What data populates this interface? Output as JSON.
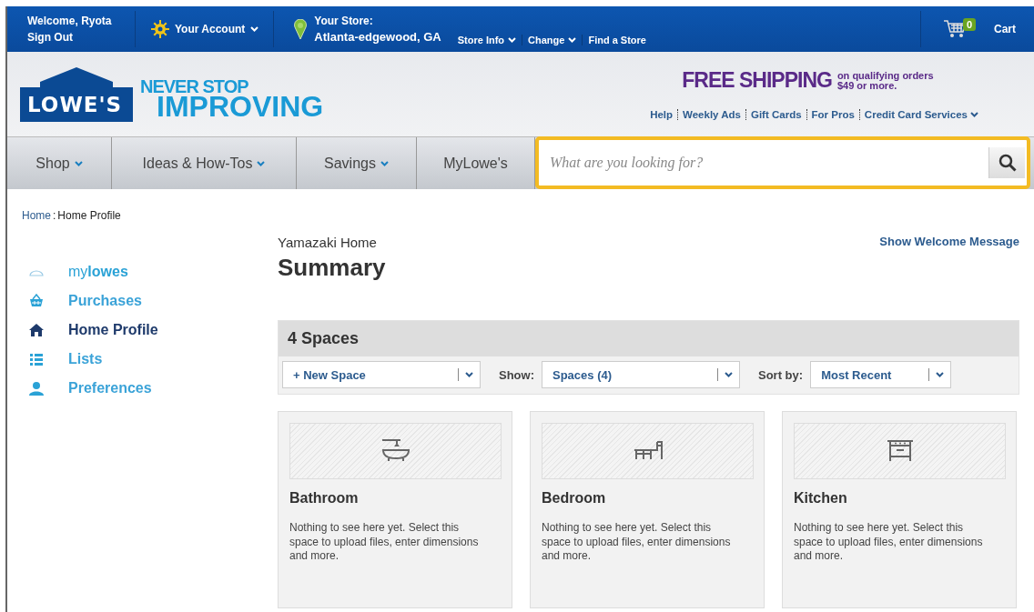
{
  "top_bar": {
    "welcome": "Welcome, Ryota",
    "sign_out": "Sign Out",
    "account": "Your Account",
    "store_label": "Your Store:",
    "store_name": "Atlanta-edgewood, GA",
    "store_links": [
      {
        "label": "Store Info",
        "dropdown": true
      },
      {
        "label": "Change",
        "dropdown": true
      },
      {
        "label": "Find a Store",
        "dropdown": false
      }
    ],
    "cart_count": "0",
    "cart": "Cart"
  },
  "header": {
    "logo": "LOWE'S",
    "tagline_top": "NEVER STOP",
    "tagline_bottom": "IMPROVING",
    "shipping": "FREE SHIPPING",
    "shipping_note": "on qualifying orders $49 or more.",
    "links": [
      {
        "label": "Help",
        "dropdown": false
      },
      {
        "label": "Weekly Ads",
        "dropdown": false
      },
      {
        "label": "Gift Cards",
        "dropdown": false
      },
      {
        "label": "For Pros",
        "dropdown": false
      },
      {
        "label": "Credit Card Services",
        "dropdown": true
      }
    ]
  },
  "nav": {
    "tabs": [
      {
        "label": "Shop",
        "dropdown": true
      },
      {
        "label": "Ideas & How-Tos",
        "dropdown": true
      },
      {
        "label": "Savings",
        "dropdown": true
      },
      {
        "label": "MyLowe's",
        "dropdown": false
      }
    ],
    "search": {
      "placeholder": "What are you looking for?"
    }
  },
  "breadcrumb": {
    "home": "Home",
    "separator": ":",
    "current": "Home Profile"
  },
  "sidebar": {
    "items": [
      {
        "label": "my**lowes**",
        "kind": "cap",
        "selected": false
      },
      {
        "label": "Purchases",
        "kind": "basket",
        "selected": false
      },
      {
        "label": "Home Profile",
        "kind": "house",
        "selected": true
      },
      {
        "label": "Lists",
        "kind": "list",
        "selected": false
      },
      {
        "label": "Preferences",
        "kind": "person",
        "selected": false
      }
    ]
  },
  "main": {
    "home_name": "Yamazaki Home",
    "title": "Summary",
    "welcome_link": "Show Welcome Message",
    "spaces_title": "4 Spaces",
    "toolbar": {
      "new_space": "+ New Space",
      "show_label": "Show:",
      "show_value": "Spaces (4)",
      "sort_label": "Sort by:",
      "sort_value": "Most Recent"
    },
    "spaces": [
      {
        "name": "Bathroom",
        "kind": "bathtub",
        "text": "Nothing to see here yet. Select this space to upload files, enter dimensions and more."
      },
      {
        "name": "Bedroom",
        "kind": "desk",
        "text": "Nothing to see here yet. Select this space to upload files, enter dimensions and more."
      },
      {
        "name": "Kitchen",
        "kind": "stove",
        "text": "Nothing to see here yet. Select this space to upload files, enter dimensions and more."
      }
    ]
  }
}
